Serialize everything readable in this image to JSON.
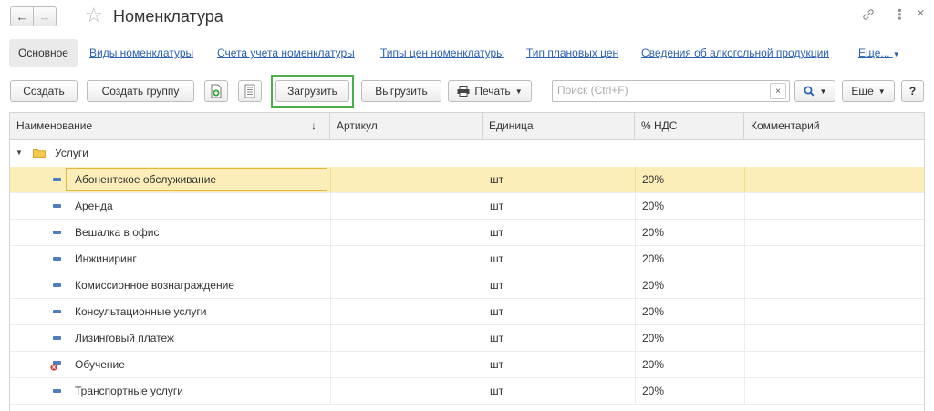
{
  "window": {
    "title": "Номенклатура",
    "back_icon": "arrow-left-icon",
    "forward_icon": "arrow-right-icon",
    "favorite_icon": "star-icon",
    "link_icon": "link-icon",
    "more_icon": "more-vertical-icon",
    "close_icon": "close-icon"
  },
  "tabs": {
    "active": "Основное",
    "links": [
      "Виды номенклатуры",
      "Счета учета номенклатуры",
      "Типы цен номенклатуры",
      "Тип плановых цен",
      "Сведения об алкогольной продукции",
      "Еще..."
    ]
  },
  "toolbar": {
    "create": "Создать",
    "create_group": "Создать группу",
    "load": "Загрузить",
    "unload": "Выгрузить",
    "print": "Печать",
    "more": "Еще",
    "help": "?",
    "search_placeholder": "Поиск (Ctrl+F)",
    "search_value": ""
  },
  "table": {
    "columns": [
      "Наименование",
      "Артикул",
      "Единица",
      "% НДС",
      "Комментарий"
    ],
    "sort_indicator": "↓",
    "group": "Услуги",
    "rows": [
      {
        "name": "Абонентское обслуживание",
        "article": "",
        "unit": "шт",
        "vat": "20%",
        "comment": "",
        "icon": "item-icon"
      },
      {
        "name": "Аренда",
        "article": "",
        "unit": "шт",
        "vat": "20%",
        "comment": "",
        "icon": "item-icon"
      },
      {
        "name": "Вешалка в офис",
        "article": "",
        "unit": "шт",
        "vat": "20%",
        "comment": "",
        "icon": "item-icon"
      },
      {
        "name": "Инжиниринг",
        "article": "",
        "unit": "шт",
        "vat": "20%",
        "comment": "",
        "icon": "item-icon"
      },
      {
        "name": "Комиссионное вознаграждение",
        "article": "",
        "unit": "шт",
        "vat": "20%",
        "comment": "",
        "icon": "item-icon"
      },
      {
        "name": "Консультационные услуги",
        "article": "",
        "unit": "шт",
        "vat": "20%",
        "comment": "",
        "icon": "item-icon"
      },
      {
        "name": "Лизинговый платеж",
        "article": "",
        "unit": "шт",
        "vat": "20%",
        "comment": "",
        "icon": "item-icon"
      },
      {
        "name": "Обучение",
        "article": "",
        "unit": "шт",
        "vat": "20%",
        "comment": "",
        "icon": "item-deleted-icon"
      },
      {
        "name": "Транспортные услуги",
        "article": "",
        "unit": "шт",
        "vat": "20%",
        "comment": "",
        "icon": "item-icon"
      }
    ]
  },
  "colors": {
    "link": "#2c62b4",
    "selected_row": "#fbeeb8",
    "highlight_frame": "#4cae48",
    "item_icon": "#4f7ec0"
  }
}
